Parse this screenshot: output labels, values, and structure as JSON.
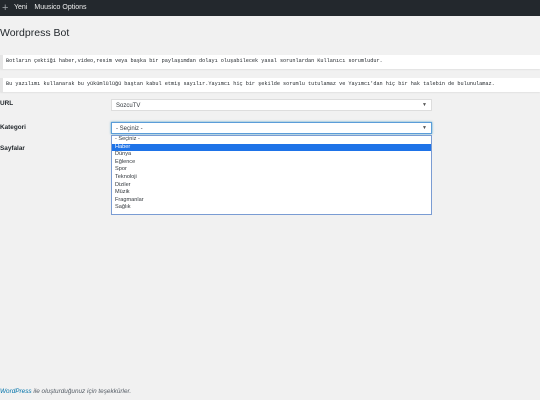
{
  "adminbar": {
    "plus_icon": "plus-icon",
    "new_label": "Yeni",
    "plugin_label": "Muusico Options"
  },
  "page": {
    "title": "Wordpress Bot"
  },
  "notices": [
    "Botların çektiği haber,video,resim veya başka bir paylaşımdan dolayı oluşabilecek yasal sorunlardan Kullanıcı sorumludur.",
    "Bu yazılımı kullanarak bu yükümlülüğü baştan kabul etmiş sayılır.Yayımcı hiç bir şekilde sorumlu tutulamaz ve Yayımcı'dan hiç bir hak talebin de bulunulamaz."
  ],
  "form": {
    "url_label": "URL",
    "url_value": "SozcuTV",
    "kategori_label": "Kategori",
    "kategori_value": "- Seçiniz -",
    "sayfalar_label": "Sayfalar",
    "dropdown_options": [
      "- Seçiniz -",
      "Haber",
      "Dünya",
      "Eğlence",
      "Spor",
      "Teknoloji",
      "Diziler",
      "Müzik",
      "Fragmanlar",
      "Sağlık"
    ],
    "dropdown_selected_index": 1
  },
  "footer": {
    "link": "WordPress",
    "text": " ile oluşturduğunuz için teşekkürler."
  }
}
